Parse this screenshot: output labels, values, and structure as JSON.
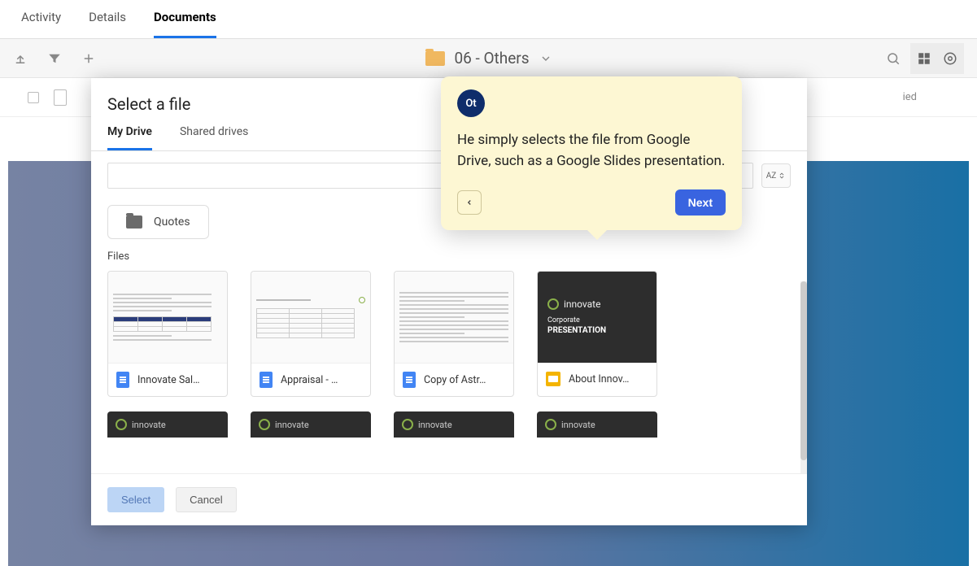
{
  "top_tabs": {
    "activity": "Activity",
    "details": "Details",
    "documents": "Documents"
  },
  "toolbar": {
    "folder_name": "06 - Others"
  },
  "row_behind": {
    "right_text": "ied"
  },
  "modal": {
    "title": "Select a file",
    "tabs": {
      "my_drive": "My Drive",
      "shared": "Shared drives"
    },
    "sort_label": "AZ",
    "folder_chip": "Quotes",
    "files_label": "Files",
    "files": [
      {
        "name": "Innovate Sal…"
      },
      {
        "name": "Appraisal - …"
      },
      {
        "name": "Copy of Astr…"
      },
      {
        "name": "About Innov…"
      }
    ],
    "thumb_brand": "innovate",
    "thumb_sub1": "Corporate",
    "thumb_sub2": "PRESENTATION",
    "footer": {
      "select": "Select",
      "cancel": "Cancel"
    }
  },
  "callout": {
    "badge": "Ot",
    "text": "He simply selects the file from Google Drive, such as a Google Slides presentation.",
    "next": "Next"
  }
}
